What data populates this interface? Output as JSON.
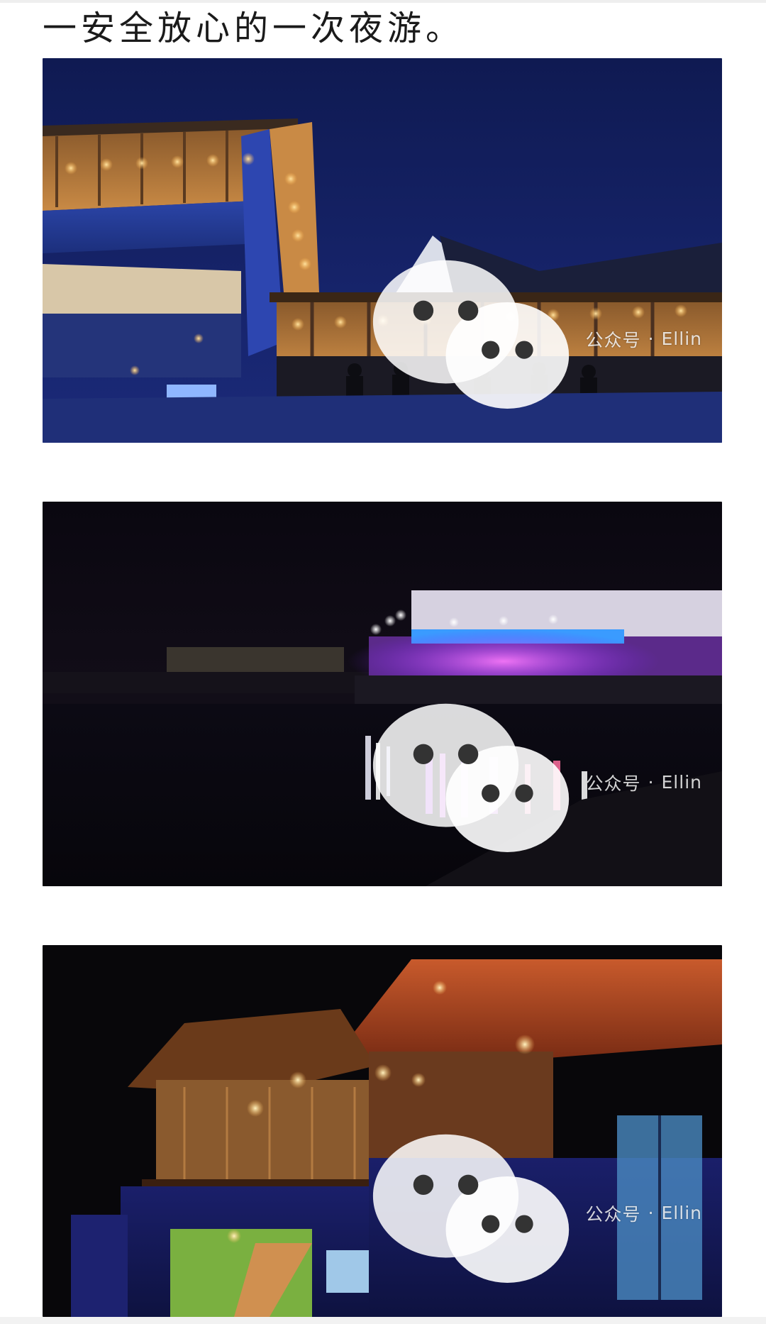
{
  "article": {
    "text_line": "一安全放心的一次夜游。"
  },
  "photos": [
    {
      "name": "night-restaurant-balcony-photo",
      "watermark": {
        "account_label": "公众号",
        "separator": "·",
        "author": "Ellin"
      }
    },
    {
      "name": "waterfront-lights-reflection-photo",
      "watermark": {
        "account_label": "公众号",
        "separator": "·",
        "author": "Ellin"
      }
    },
    {
      "name": "wooden-house-night-photo",
      "watermark": {
        "account_label": "公众号",
        "separator": "·",
        "author": "Ellin"
      }
    }
  ],
  "icons": {
    "watermark_icon": "wechat-icon"
  },
  "colors": {
    "text": "#1a1a1a",
    "background": "#ffffff",
    "sky_blue": "#16205a",
    "neon_purple": "#b040ff",
    "warm_light": "#ffcf7a"
  }
}
